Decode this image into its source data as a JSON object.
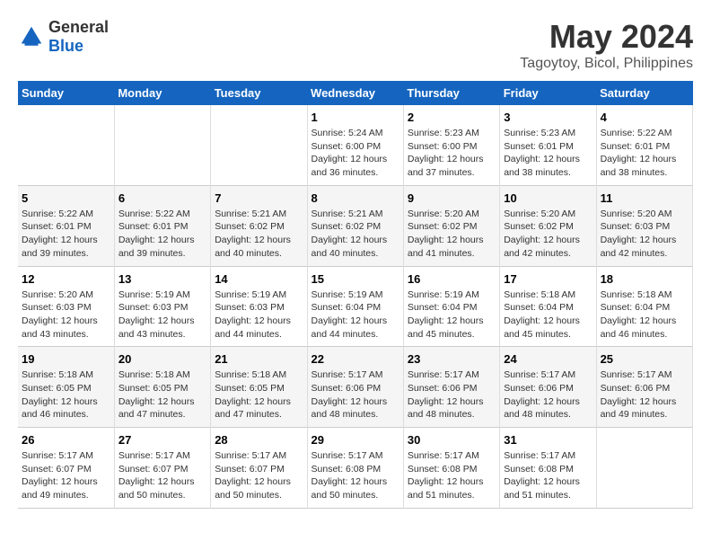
{
  "logo": {
    "general": "General",
    "blue": "Blue"
  },
  "title": "May 2024",
  "subtitle": "Tagoytoy, Bicol, Philippines",
  "days_of_week": [
    "Sunday",
    "Monday",
    "Tuesday",
    "Wednesday",
    "Thursday",
    "Friday",
    "Saturday"
  ],
  "weeks": [
    [
      {
        "day": "",
        "info": ""
      },
      {
        "day": "",
        "info": ""
      },
      {
        "day": "",
        "info": ""
      },
      {
        "day": "1",
        "info": "Sunrise: 5:24 AM\nSunset: 6:00 PM\nDaylight: 12 hours and 36 minutes."
      },
      {
        "day": "2",
        "info": "Sunrise: 5:23 AM\nSunset: 6:00 PM\nDaylight: 12 hours and 37 minutes."
      },
      {
        "day": "3",
        "info": "Sunrise: 5:23 AM\nSunset: 6:01 PM\nDaylight: 12 hours and 38 minutes."
      },
      {
        "day": "4",
        "info": "Sunrise: 5:22 AM\nSunset: 6:01 PM\nDaylight: 12 hours and 38 minutes."
      }
    ],
    [
      {
        "day": "5",
        "info": "Sunrise: 5:22 AM\nSunset: 6:01 PM\nDaylight: 12 hours and 39 minutes."
      },
      {
        "day": "6",
        "info": "Sunrise: 5:22 AM\nSunset: 6:01 PM\nDaylight: 12 hours and 39 minutes."
      },
      {
        "day": "7",
        "info": "Sunrise: 5:21 AM\nSunset: 6:02 PM\nDaylight: 12 hours and 40 minutes."
      },
      {
        "day": "8",
        "info": "Sunrise: 5:21 AM\nSunset: 6:02 PM\nDaylight: 12 hours and 40 minutes."
      },
      {
        "day": "9",
        "info": "Sunrise: 5:20 AM\nSunset: 6:02 PM\nDaylight: 12 hours and 41 minutes."
      },
      {
        "day": "10",
        "info": "Sunrise: 5:20 AM\nSunset: 6:02 PM\nDaylight: 12 hours and 42 minutes."
      },
      {
        "day": "11",
        "info": "Sunrise: 5:20 AM\nSunset: 6:03 PM\nDaylight: 12 hours and 42 minutes."
      }
    ],
    [
      {
        "day": "12",
        "info": "Sunrise: 5:20 AM\nSunset: 6:03 PM\nDaylight: 12 hours and 43 minutes."
      },
      {
        "day": "13",
        "info": "Sunrise: 5:19 AM\nSunset: 6:03 PM\nDaylight: 12 hours and 43 minutes."
      },
      {
        "day": "14",
        "info": "Sunrise: 5:19 AM\nSunset: 6:03 PM\nDaylight: 12 hours and 44 minutes."
      },
      {
        "day": "15",
        "info": "Sunrise: 5:19 AM\nSunset: 6:04 PM\nDaylight: 12 hours and 44 minutes."
      },
      {
        "day": "16",
        "info": "Sunrise: 5:19 AM\nSunset: 6:04 PM\nDaylight: 12 hours and 45 minutes."
      },
      {
        "day": "17",
        "info": "Sunrise: 5:18 AM\nSunset: 6:04 PM\nDaylight: 12 hours and 45 minutes."
      },
      {
        "day": "18",
        "info": "Sunrise: 5:18 AM\nSunset: 6:04 PM\nDaylight: 12 hours and 46 minutes."
      }
    ],
    [
      {
        "day": "19",
        "info": "Sunrise: 5:18 AM\nSunset: 6:05 PM\nDaylight: 12 hours and 46 minutes."
      },
      {
        "day": "20",
        "info": "Sunrise: 5:18 AM\nSunset: 6:05 PM\nDaylight: 12 hours and 47 minutes."
      },
      {
        "day": "21",
        "info": "Sunrise: 5:18 AM\nSunset: 6:05 PM\nDaylight: 12 hours and 47 minutes."
      },
      {
        "day": "22",
        "info": "Sunrise: 5:17 AM\nSunset: 6:06 PM\nDaylight: 12 hours and 48 minutes."
      },
      {
        "day": "23",
        "info": "Sunrise: 5:17 AM\nSunset: 6:06 PM\nDaylight: 12 hours and 48 minutes."
      },
      {
        "day": "24",
        "info": "Sunrise: 5:17 AM\nSunset: 6:06 PM\nDaylight: 12 hours and 48 minutes."
      },
      {
        "day": "25",
        "info": "Sunrise: 5:17 AM\nSunset: 6:06 PM\nDaylight: 12 hours and 49 minutes."
      }
    ],
    [
      {
        "day": "26",
        "info": "Sunrise: 5:17 AM\nSunset: 6:07 PM\nDaylight: 12 hours and 49 minutes."
      },
      {
        "day": "27",
        "info": "Sunrise: 5:17 AM\nSunset: 6:07 PM\nDaylight: 12 hours and 50 minutes."
      },
      {
        "day": "28",
        "info": "Sunrise: 5:17 AM\nSunset: 6:07 PM\nDaylight: 12 hours and 50 minutes."
      },
      {
        "day": "29",
        "info": "Sunrise: 5:17 AM\nSunset: 6:08 PM\nDaylight: 12 hours and 50 minutes."
      },
      {
        "day": "30",
        "info": "Sunrise: 5:17 AM\nSunset: 6:08 PM\nDaylight: 12 hours and 51 minutes."
      },
      {
        "day": "31",
        "info": "Sunrise: 5:17 AM\nSunset: 6:08 PM\nDaylight: 12 hours and 51 minutes."
      },
      {
        "day": "",
        "info": ""
      }
    ]
  ]
}
